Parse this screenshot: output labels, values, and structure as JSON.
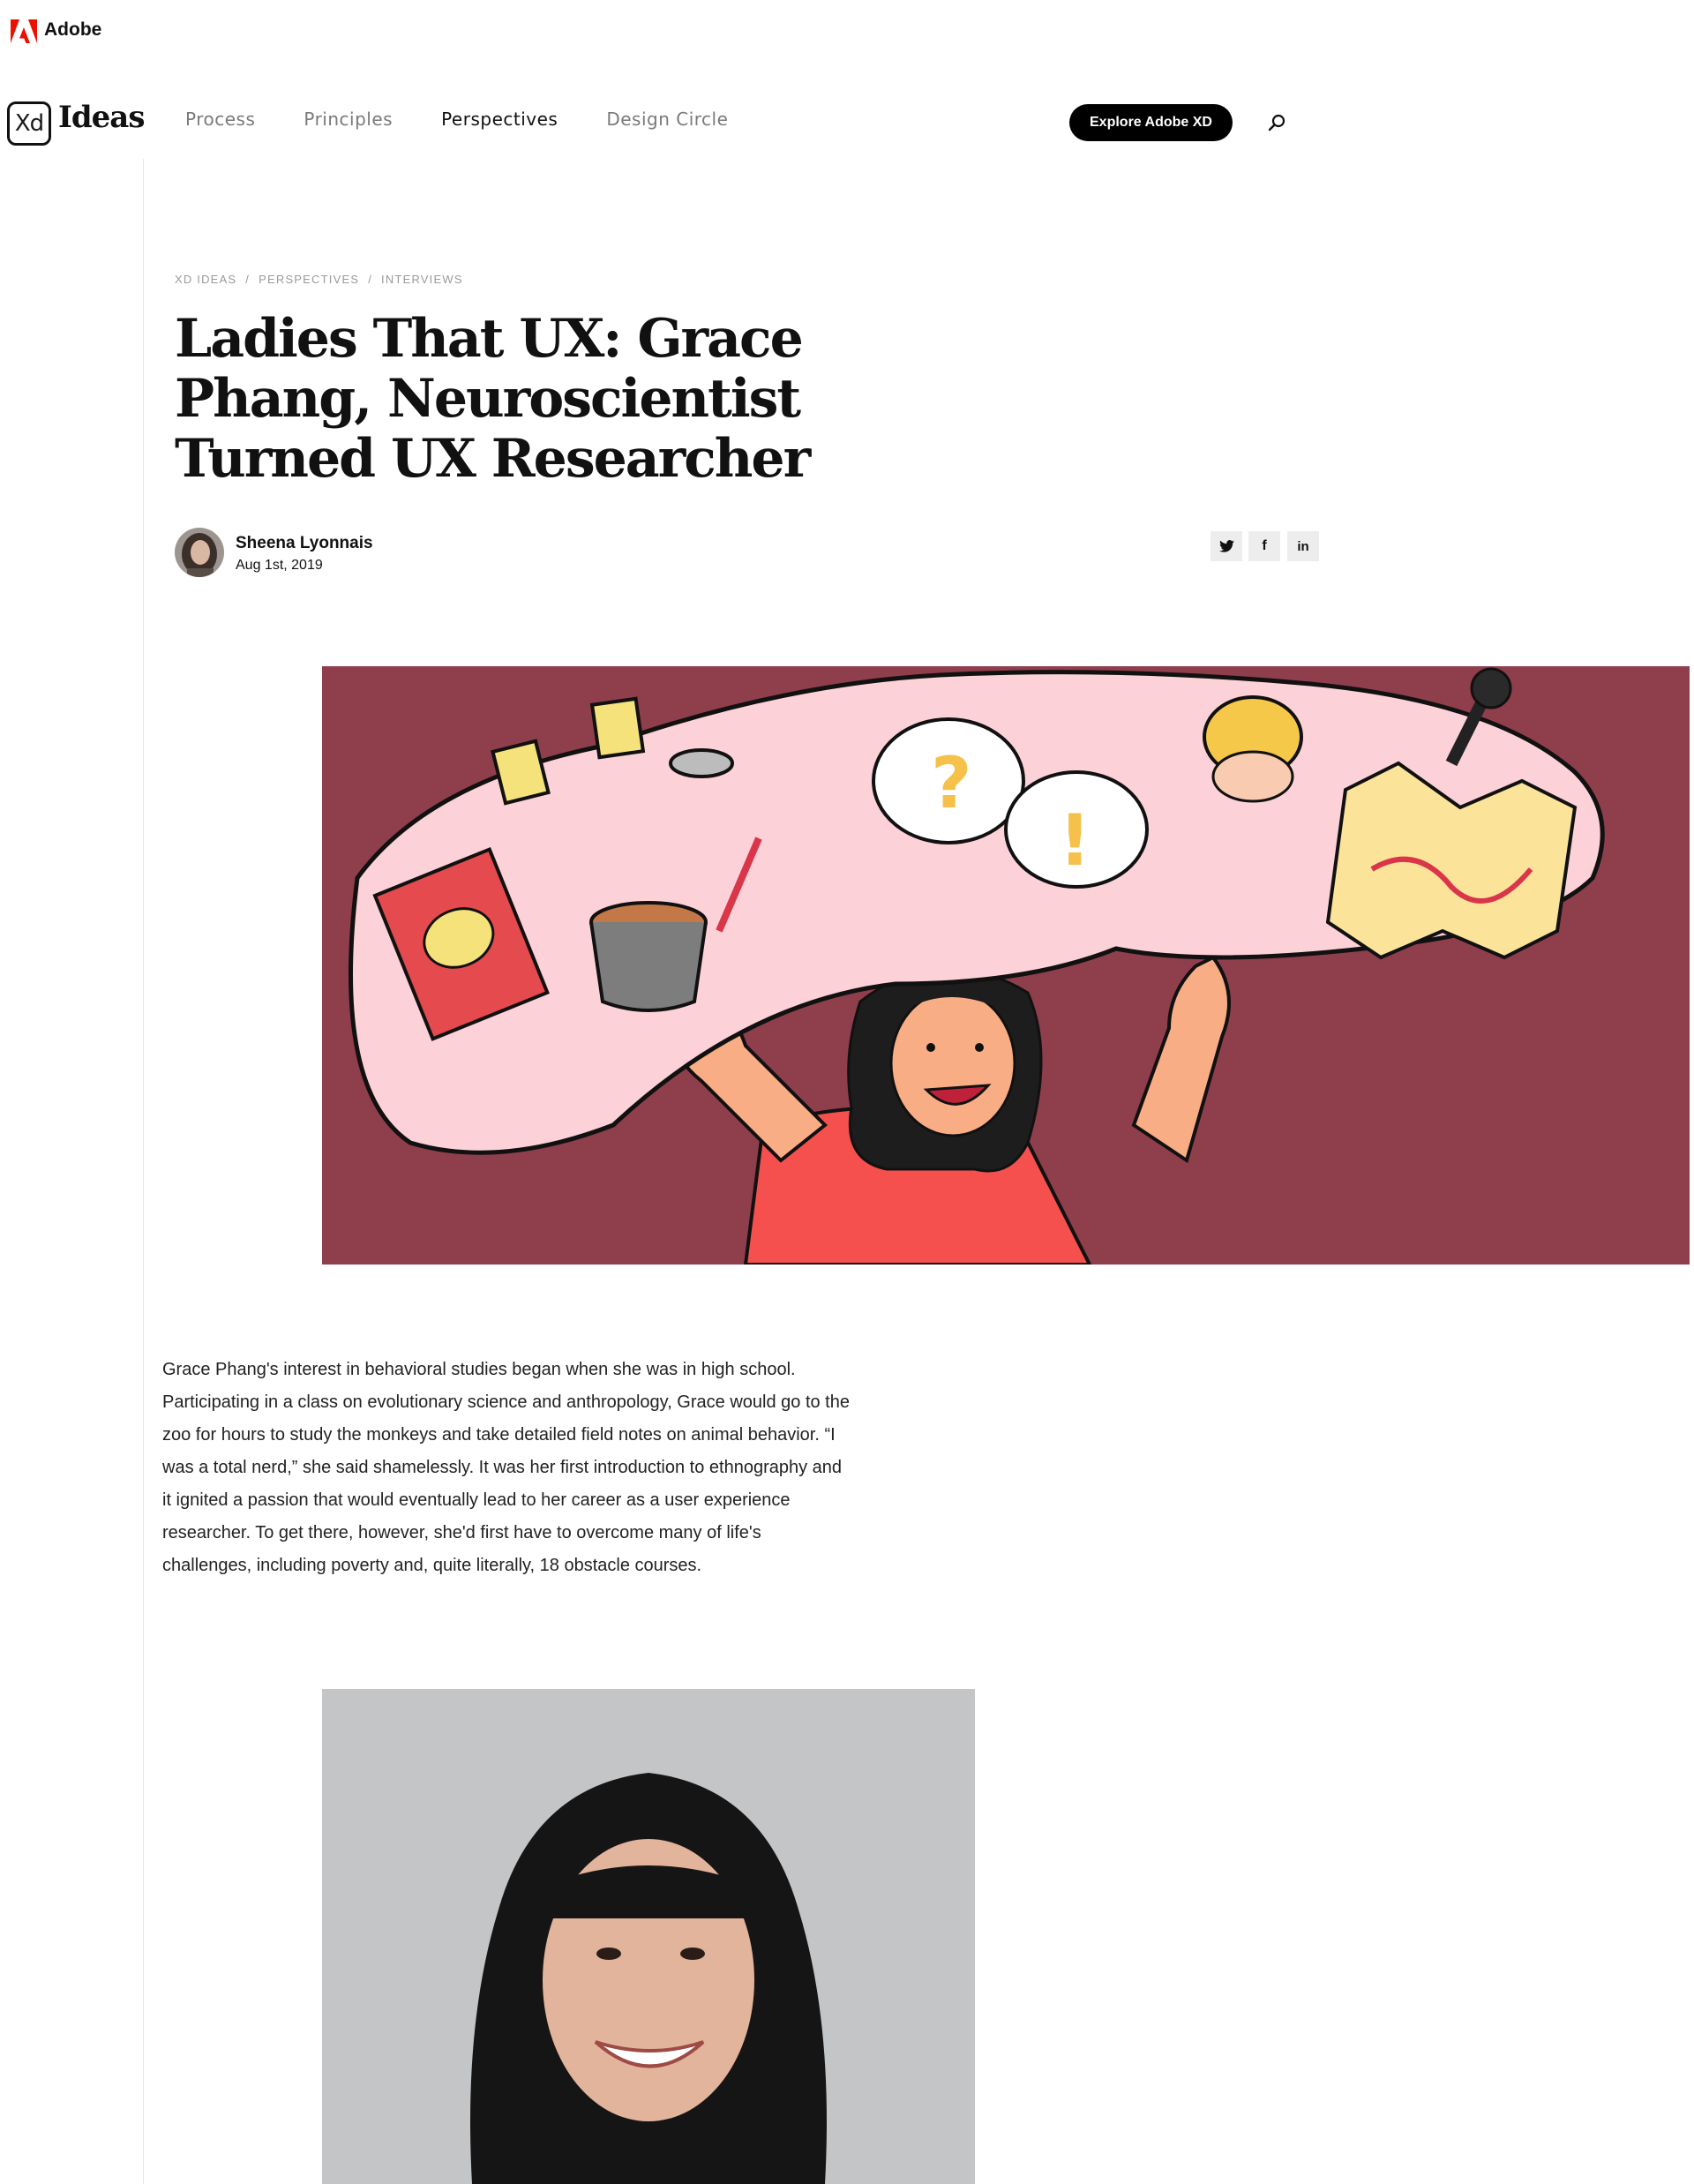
{
  "adobe_bar": {
    "brand": "Adobe",
    "brand_color": "#eb1000"
  },
  "header": {
    "logo_badge": "Xd",
    "logo_word": "Ideas",
    "nav": [
      {
        "label": "Process",
        "active": false
      },
      {
        "label": "Principles",
        "active": false
      },
      {
        "label": "Perspectives",
        "active": true
      },
      {
        "label": "Design Circle",
        "active": false
      }
    ],
    "cta_label": "Explore Adobe XD",
    "search_icon": "search-icon"
  },
  "breadcrumb": {
    "items": [
      "XD IDEAS",
      "PERSPECTIVES",
      "INTERVIEWS"
    ],
    "separator": "/"
  },
  "article": {
    "title": "Ladies That UX: Grace Phang, Neuroscientist Turned UX Researcher",
    "author": "Sheena Lyonnais",
    "date": "Aug 1st, 2019",
    "share": [
      {
        "icon": "twitter-icon",
        "glyph": "🐦"
      },
      {
        "icon": "facebook-icon",
        "glyph": "f"
      },
      {
        "icon": "linkedin-icon",
        "glyph": "in"
      }
    ],
    "intro": "Grace Phang's interest in behavioral studies began when she was in high school. Participating in a class on evolutionary science and anthropology, Grace would go to the zoo for hours to study the monkeys and take detailed field notes on animal behavior. “I was a total nerd,” she said shamelessly. It was her first introduction to ethnography and it ignited a passion that would eventually lead to her career as a user experience researcher. To get there, however, she'd first have to overcome many of life's challenges, including poverty and, quite literally, 18 obstacle courses."
  },
  "colors": {
    "hero_bg": "#8f3e4c",
    "brain_pink": "#fcd2d8",
    "portrait_bg": "#c4c5c7"
  }
}
